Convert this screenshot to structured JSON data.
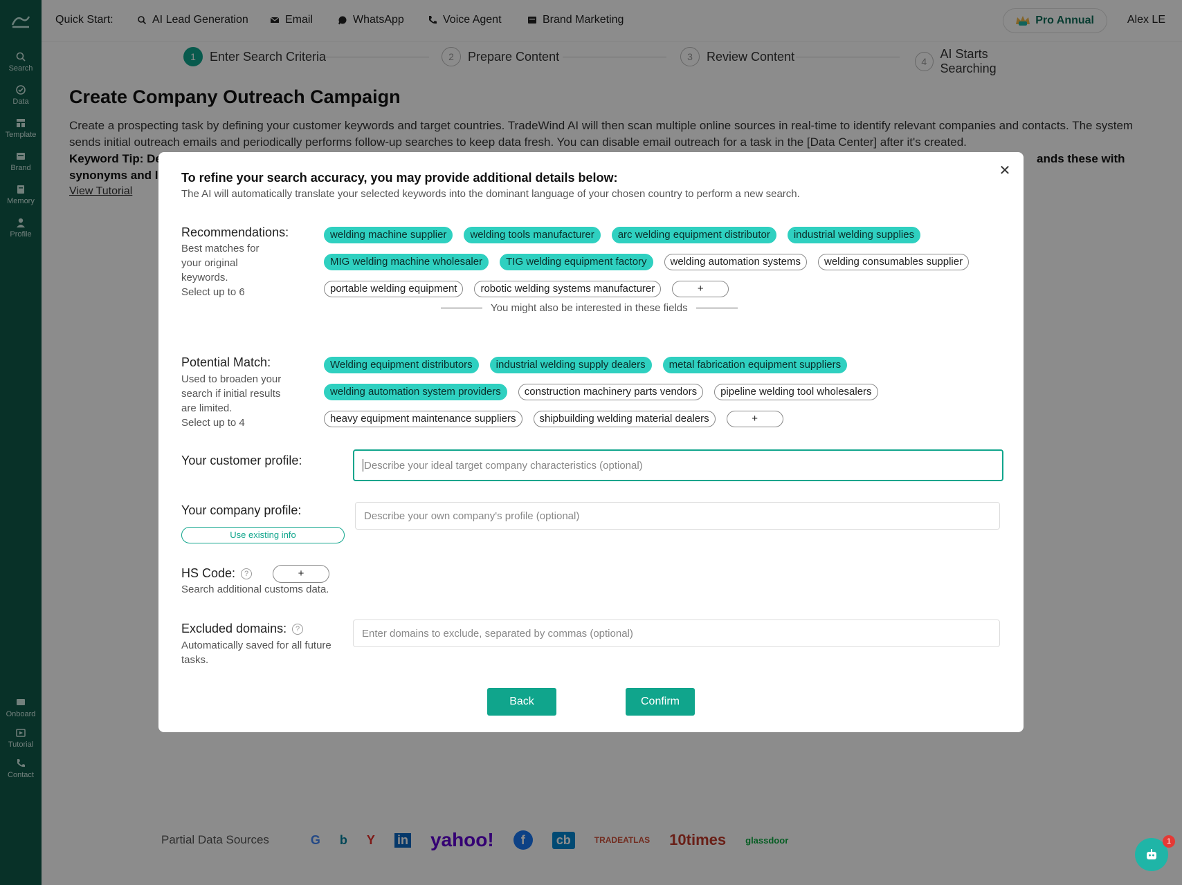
{
  "sidebar": {
    "items": [
      {
        "label": "Search",
        "icon": "search-icon"
      },
      {
        "label": "Data",
        "icon": "data-icon"
      },
      {
        "label": "Template",
        "icon": "template-icon"
      },
      {
        "label": "Brand",
        "icon": "brand-icon"
      },
      {
        "label": "Memory",
        "icon": "memory-icon"
      },
      {
        "label": "Profile",
        "icon": "profile-icon"
      },
      {
        "label": "Onboard",
        "icon": "onboard-icon"
      },
      {
        "label": "Tutorial",
        "icon": "tutorial-icon"
      },
      {
        "label": "Contact",
        "icon": "phone-icon"
      }
    ]
  },
  "topbar": {
    "quick_start_label": "Quick Start:",
    "items": [
      {
        "label": "AI Lead Generation",
        "icon": "search-icon"
      },
      {
        "label": "Email",
        "icon": "mail-icon"
      },
      {
        "label": "WhatsApp",
        "icon": "whatsapp-icon"
      },
      {
        "label": "Voice Agent",
        "icon": "phone-icon"
      },
      {
        "label": "Brand Marketing",
        "icon": "brand-icon"
      }
    ],
    "plan_label": "Pro Annual",
    "user_name": "Alex LE"
  },
  "stepper": {
    "steps": [
      {
        "num": "1",
        "label": "Enter Search Criteria"
      },
      {
        "num": "2",
        "label": "Prepare Content"
      },
      {
        "num": "3",
        "label": "Review Content"
      },
      {
        "num": "4",
        "label": "AI Starts Searching"
      }
    ]
  },
  "page": {
    "title": "Create Company Outreach Campaign",
    "description": "Create a prospecting task by defining your customer keywords and target countries. TradeWind AI will then scan multiple online sources in real-time to identify relevant companies and contacts. The system sends initial outreach emails and periodically performs follow-up searches to keep data fresh. You can disable email outreach for a task in the [Data Center] after it's created.",
    "keyword_tip_start": "Keyword Tip: De",
    "keyword_tip_end": "ands these with",
    "keyword_tip_line2": "synonyms and l",
    "view_tutorial": "View Tutorial",
    "sources_label": "Partial Data Sources",
    "sources": [
      "G",
      "b",
      "Y",
      "in",
      "yahoo!",
      "f",
      "cb",
      "TRADEATLAS",
      "10times",
      "glassdoor"
    ]
  },
  "modal": {
    "title": "To refine your search accuracy, you may provide additional details below:",
    "subtitle": "The AI will automatically translate your selected keywords into the dominant language of your chosen country to perform a new search.",
    "recommendations": {
      "label": "Recommendations:",
      "note_lines": [
        "Best matches for",
        "your original",
        "keywords.",
        "Select up to 6"
      ],
      "rows": [
        [
          {
            "text": "welding machine supplier",
            "selected": true
          },
          {
            "text": "welding tools manufacturer",
            "selected": true
          },
          {
            "text": "arc welding equipment distributor",
            "selected": true
          },
          {
            "text": "industrial welding supplies",
            "selected": true
          }
        ],
        [
          {
            "text": "MIG welding machine wholesaler",
            "selected": true
          },
          {
            "text": "TIG welding equipment factory",
            "selected": true
          },
          {
            "text": "welding automation systems",
            "selected": false
          },
          {
            "text": "welding consumables supplier",
            "selected": false
          }
        ],
        [
          {
            "text": "portable welding equipment",
            "selected": false
          },
          {
            "text": "robotic welding systems manufacturer",
            "selected": false
          }
        ]
      ],
      "add_label": "+"
    },
    "divider_text": "You might also be interested in these fields",
    "potential": {
      "label": "Potential Match:",
      "note_lines": [
        "Used to broaden your",
        "search if initial results",
        "are limited.",
        "Select up to 4"
      ],
      "rows": [
        [
          {
            "text": "Welding equipment distributors",
            "selected": true
          },
          {
            "text": "industrial welding supply dealers",
            "selected": true
          },
          {
            "text": "metal fabrication equipment suppliers",
            "selected": true
          }
        ],
        [
          {
            "text": "welding automation system providers",
            "selected": true
          },
          {
            "text": "construction machinery parts vendors",
            "selected": false
          },
          {
            "text": "pipeline welding tool wholesalers",
            "selected": false
          }
        ],
        [
          {
            "text": "heavy equipment maintenance suppliers",
            "selected": false
          },
          {
            "text": "shipbuilding welding material dealers",
            "selected": false
          }
        ]
      ],
      "add_label": "+"
    },
    "customer_profile": {
      "label": "Your customer profile:",
      "placeholder": "Describe your ideal target company characteristics (optional)"
    },
    "company_profile": {
      "label": "Your company profile:",
      "placeholder": "Describe your own company's profile (optional)",
      "use_existing": "Use existing info"
    },
    "hs_code": {
      "label": "HS Code:",
      "note": "Search additional customs data.",
      "add_label": "+"
    },
    "excluded_domains": {
      "label": "Excluded domains:",
      "note_lines": [
        "Automatically saved for all future",
        "tasks."
      ],
      "placeholder": "Enter domains to exclude, separated by commas (optional)"
    },
    "back_label": "Back",
    "confirm_label": "Confirm"
  },
  "chat": {
    "badge": "1"
  },
  "colors": {
    "accent": "#10a58c",
    "sidebar": "#0f5a4a",
    "tag_selected": "#2fd0c0"
  }
}
